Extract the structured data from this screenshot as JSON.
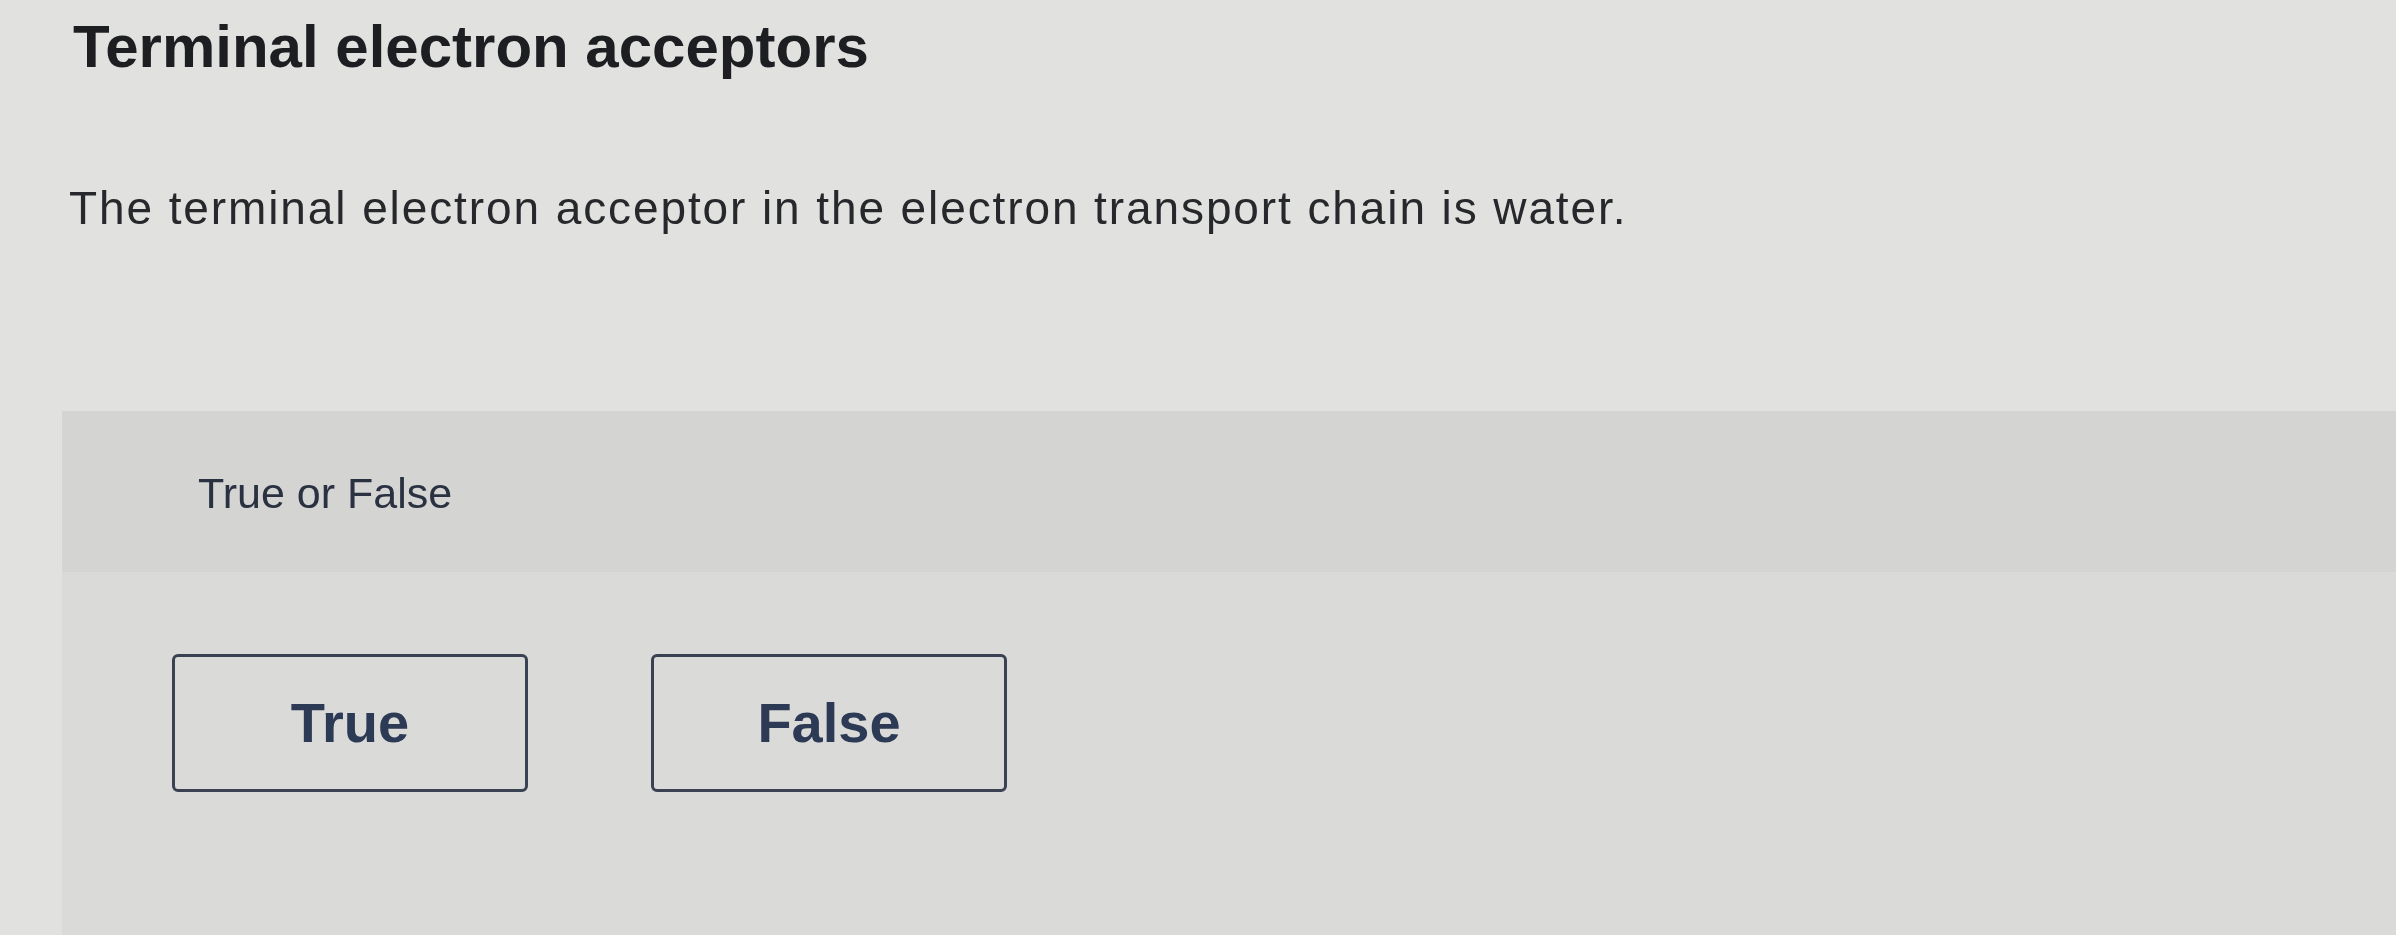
{
  "title": "Terminal electron acceptors",
  "question": "The terminal electron acceptor in the electron transport chain is water.",
  "answer_panel": {
    "prompt": "True or False",
    "options": [
      {
        "label": "True",
        "selected": false
      },
      {
        "label": "False",
        "selected": false
      }
    ]
  }
}
